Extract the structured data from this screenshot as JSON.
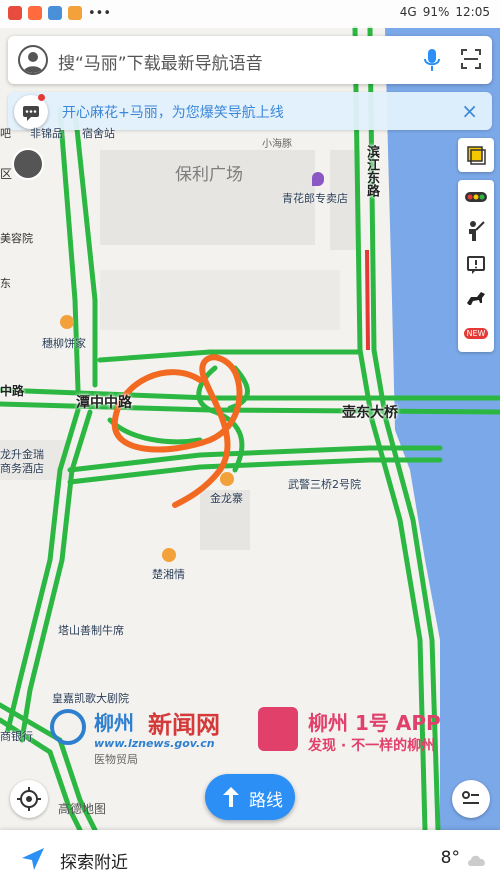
{
  "status_bar": {
    "battery": "91%",
    "time": "12:05",
    "network": "4G",
    "app_icon_colors": [
      "#e74c3c",
      "#ff6b3d",
      "#4a90d9",
      "#f3a13a"
    ]
  },
  "search": {
    "placeholder": "搜“马丽”下载最新导航语音",
    "icons": [
      "avatar-icon",
      "microphone-icon",
      "scan-icon"
    ]
  },
  "banner": {
    "text": "开心麻花+马丽，为您爆笑导航上线",
    "close": "×"
  },
  "toolbar": {
    "items": [
      "layers-icon",
      "traffic-icon",
      "report-icon",
      "feedback-icon",
      "horse-icon"
    ],
    "new_badge": "NEW"
  },
  "map": {
    "areas": [
      "保利广场"
    ],
    "roads": [
      "滨江东路",
      "潭中中路",
      "壶东大桥"
    ],
    "road_fragments": [
      "小海豚",
      "中路"
    ],
    "pois": [
      "青花郎专卖店",
      "穗柳饼家",
      "金龙寨",
      "武警三桥2号院",
      "楚湘情",
      "塔山善制牛席",
      "皇嘉凯歌大剧院",
      "龙升金瑞",
      "商务酒店",
      "美容院",
      "商银行",
      "非锦品",
      "宿舍站"
    ],
    "left_edge_fragments": [
      "吧",
      "区",
      "东"
    ],
    "colors": {
      "road_clear": "#2cb742",
      "road_jam": "#e53935",
      "river": "#7ba8e8",
      "annotation": "#f26a22"
    }
  },
  "watermark": {
    "brand1": "柳州",
    "brand1_cn": "新闻网",
    "url": "www.lznews.gov.cn",
    "brand2": "柳州 1号 APP",
    "slogan": "发现 · 不一样的柳州",
    "under_text": "医物贸局"
  },
  "bottom": {
    "route_label": "路线",
    "nearby_label": "探索附近",
    "temperature": "8°",
    "map_brand": "高德地图"
  }
}
